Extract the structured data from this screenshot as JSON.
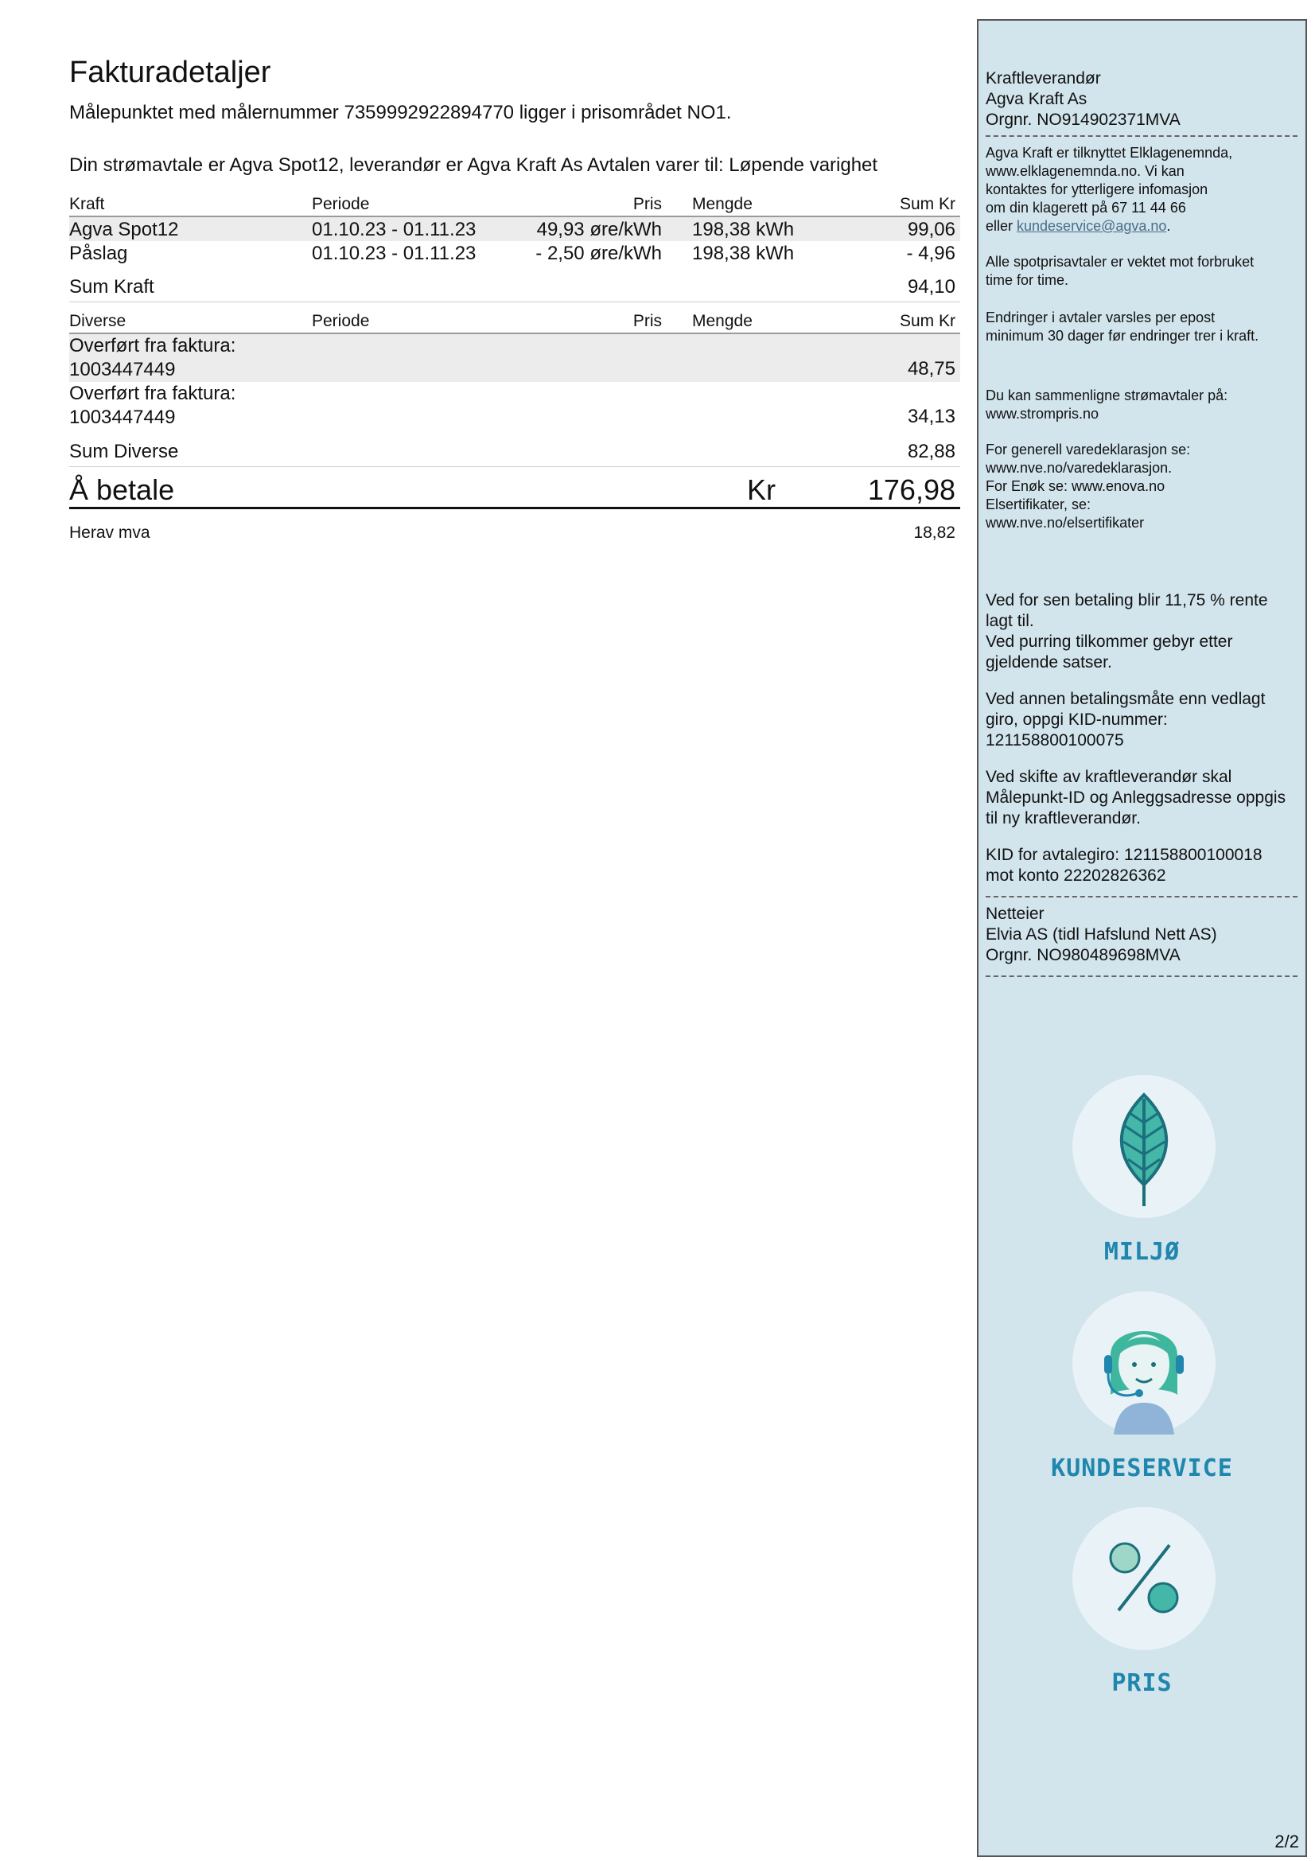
{
  "main": {
    "title": "Fakturadetaljer",
    "measurement_line": "Målepunktet med målernummer 7359992922894770 ligger i prisområdet NO1.",
    "agreement_line": "Din strømavtale er Agva Spot12, leverandør er Agva Kraft As Avtalen varer til: Løpende varighet"
  },
  "kraft": {
    "headers": [
      "Kraft",
      "Periode",
      "Pris",
      "Mengde",
      "Sum Kr"
    ],
    "rows": [
      [
        "Agva Spot12",
        "01.10.23 - 01.11.23",
        "49,93 øre/kWh",
        "198,38 kWh",
        "99,06"
      ],
      [
        "Påslag",
        "01.10.23 - 01.11.23",
        "- 2,50 øre/kWh",
        "198,38 kWh",
        "- 4,96"
      ]
    ],
    "sum_label": "Sum Kraft",
    "sum_value": "94,10"
  },
  "diverse": {
    "headers": [
      "Diverse",
      "Periode",
      "Pris",
      "Mengde",
      "Sum Kr"
    ],
    "rows": [
      [
        "Overført fra faktura:",
        "1003447449",
        "48,75"
      ],
      [
        "Overført fra faktura:",
        "1003447449",
        "34,13"
      ]
    ],
    "sum_label": "Sum Diverse",
    "sum_value": "82,88"
  },
  "total": {
    "label": "Å betale",
    "currency": "Kr",
    "value": "176,98",
    "vat_label": "Herav mva",
    "vat_value": "18,82"
  },
  "sidebar": {
    "supplier_heading": "Kraftleverandør",
    "supplier_name": "Agva Kraft As",
    "supplier_orgnr": "Orgnr. NO914902371MVA",
    "complaint_1": "Agva Kraft er tilknyttet Elklagenemnda,",
    "complaint_2": "www.elklagenemnda.no. Vi kan",
    "complaint_3": "kontaktes for ytterligere infomasjon",
    "complaint_4": "om din klagerett på 67 11 44 66",
    "complaint_5_prefix": "eller ",
    "complaint_email": "kundeservice@agva.no",
    "complaint_5_suffix": ".",
    "spot_1": "Alle spotprisavtaler er vektet mot forbruket",
    "spot_2": "time for time.",
    "change_1": "Endringer i avtaler varsles per epost",
    "change_2": "minimum 30 dager før endringer trer i kraft.",
    "compare_1": "Du kan sammenligne strømavtaler på:",
    "compare_2": "www.strompris.no",
    "decl_1": "For generell varedeklarasjon se:",
    "decl_2": "www.nve.no/varedeklarasjon.",
    "decl_3": "For Enøk se: www.enova.no",
    "decl_4": "Elsertifikater, se:",
    "decl_5": "www.nve.no/elsertifikater",
    "late_1": "Ved for sen betaling blir 11,75 % rente",
    "late_2": "lagt til.",
    "late_3": "Ved purring tilkommer gebyr etter",
    "late_4": "gjeldende satser.",
    "kid_1": "Ved annen betalingsmåte enn vedlagt",
    "kid_2": "giro, oppgi KID-nummer:",
    "kid_3": "121158800100075",
    "switch_1": "Ved skifte av kraftleverandør skal",
    "switch_2": "Målepunkt-ID og Anleggsadresse oppgis",
    "switch_3": "til ny kraftleverandør.",
    "avtale_1": "KID for avtalegiro: 121158800100018",
    "avtale_2": "mot konto 22202826362",
    "grid_heading": "Netteier",
    "grid_name": "Elvia AS (tidl Hafslund Nett AS)",
    "grid_orgnr": "Orgnr. NO980489698MVA",
    "icon_env_label": "MILJØ",
    "icon_service_label": "KUNDESERVICE",
    "icon_price_label": "PRIS",
    "page": "2/2"
  }
}
